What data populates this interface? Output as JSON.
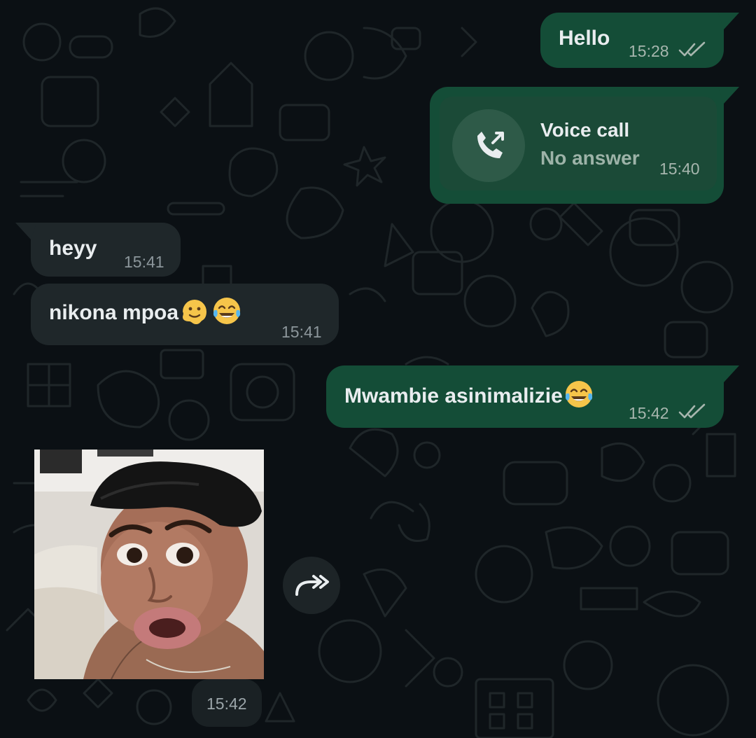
{
  "messages": [
    {
      "direction": "outgoing",
      "text": "Hello",
      "time": "15:28",
      "status": "read"
    },
    {
      "direction": "outgoing",
      "type": "voice-call",
      "title": "Voice call",
      "subtitle": "No answer",
      "time": "15:40",
      "icon": "missed-outgoing-call-icon"
    },
    {
      "direction": "incoming",
      "text": "heyy",
      "time": "15:41"
    },
    {
      "direction": "incoming",
      "text": "nikona mpoa",
      "emojis": [
        "melting-face-emoji",
        "tears-of-joy-emoji"
      ],
      "time": "15:41"
    },
    {
      "direction": "outgoing",
      "text": "Mwambie asinimalizie",
      "emojis": [
        "tears-of-joy-emoji"
      ],
      "time": "15:42",
      "status": "read"
    },
    {
      "direction": "incoming",
      "type": "image",
      "time": "15:42",
      "action_icon": "forward-icon"
    }
  ],
  "colors": {
    "background": "#0b1014",
    "outgoing_bubble": "#144d37",
    "incoming_bubble": "#1f272a",
    "text": "#e9edef",
    "meta_text": "#a7b6ae"
  }
}
